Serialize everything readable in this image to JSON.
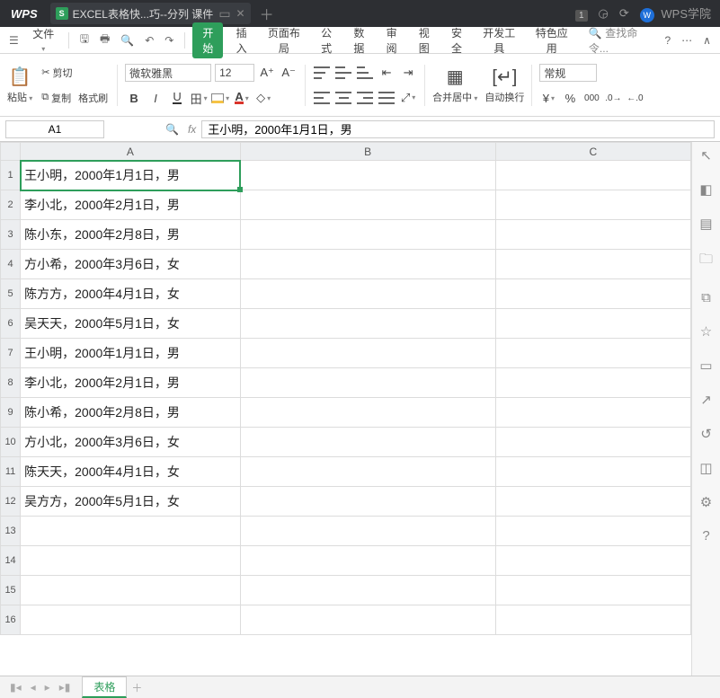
{
  "titlebar": {
    "app": "WPS",
    "tab_title": "EXCEL表格快...巧--分列 课件",
    "account": "WPS学院",
    "badge": "1"
  },
  "menubar": {
    "file": "文件",
    "tabs": [
      "开始",
      "插入",
      "页面布局",
      "公式",
      "数据",
      "审阅",
      "视图",
      "安全",
      "开发工具",
      "特色应用"
    ],
    "search_placeholder": "查找命令..."
  },
  "ribbon": {
    "paste_label": "粘贴",
    "cut": "剪切",
    "copy": "复制",
    "format_painter": "格式刷",
    "font_name": "微软雅黑",
    "font_size": "12",
    "merge_center": "合并居中",
    "wrap_text": "自动换行",
    "number_format": "常规"
  },
  "formula": {
    "cell_ref": "A1",
    "value": "王小明，2000年1月1日，男"
  },
  "columns": [
    "A",
    "B",
    "C"
  ],
  "rows": [
    "王小明，2000年1月1日，男",
    "李小北，2000年2月1日，男",
    "陈小东，2000年2月8日，男",
    "方小希，2000年3月6日，女",
    "陈方方，2000年4月1日，女",
    "吴天天，2000年5月1日，女",
    "王小明，2000年1月1日，男",
    "李小北，2000年2月1日，男",
    "陈小希，2000年2月8日，男",
    "方小北，2000年3月6日，女",
    "陈天天，2000年4月1日，女",
    "吴方方，2000年5月1日，女",
    "",
    "",
    "",
    ""
  ],
  "statusbar": {
    "sheet_name": "表格"
  }
}
